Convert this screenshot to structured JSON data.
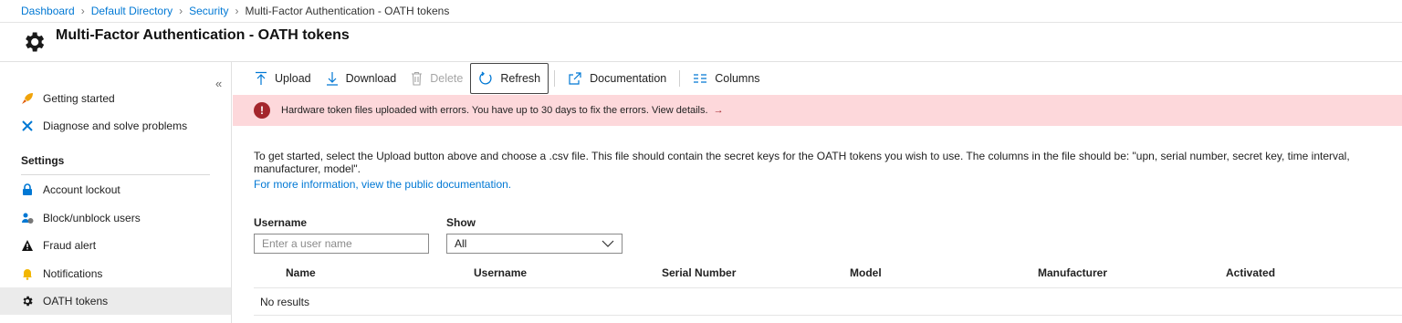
{
  "breadcrumb": {
    "items": [
      "Dashboard",
      "Default Directory",
      "Security"
    ],
    "current": "Multi-Factor Authentication - OATH tokens"
  },
  "page": {
    "title": "Multi-Factor Authentication - OATH tokens"
  },
  "sidebar": {
    "collapse_glyph": "«",
    "top_items": [
      {
        "label": "Getting started",
        "icon": "rocket-icon"
      },
      {
        "label": "Diagnose and solve problems",
        "icon": "wrench-icon"
      }
    ],
    "section_label": "Settings",
    "items": [
      {
        "label": "Account lockout",
        "icon": "lock-icon"
      },
      {
        "label": "Block/unblock users",
        "icon": "users-block-icon"
      },
      {
        "label": "Fraud alert",
        "icon": "warning-icon"
      },
      {
        "label": "Notifications",
        "icon": "bell-icon"
      },
      {
        "label": "OATH tokens",
        "icon": "gear-icon",
        "active": true
      }
    ]
  },
  "toolbar": {
    "upload": "Upload",
    "download": "Download",
    "delete": "Delete",
    "refresh": "Refresh",
    "documentation": "Documentation",
    "columns": "Columns"
  },
  "alert": {
    "message": "Hardware token files uploaded with errors. You have up to 30 days to fix the errors. View details.",
    "arrow": "→"
  },
  "description": {
    "text": "To get started, select the Upload button above and choose a .csv file. This file should contain the secret keys for the OATH tokens you wish to use. The columns in the file should be: \"upn, serial number, secret key, time interval, manufacturer, model\".",
    "link": "For more information, view the public documentation."
  },
  "filters": {
    "username_label": "Username",
    "username_placeholder": "Enter a user name",
    "show_label": "Show",
    "show_value": "All"
  },
  "table": {
    "columns": [
      "Name",
      "Username",
      "Serial Number",
      "Model",
      "Manufacturer",
      "Activated"
    ],
    "empty_text": "No results"
  },
  "colors": {
    "accent": "#0078d4",
    "error": "#a4262c",
    "alert_bg": "#fdd8db"
  }
}
